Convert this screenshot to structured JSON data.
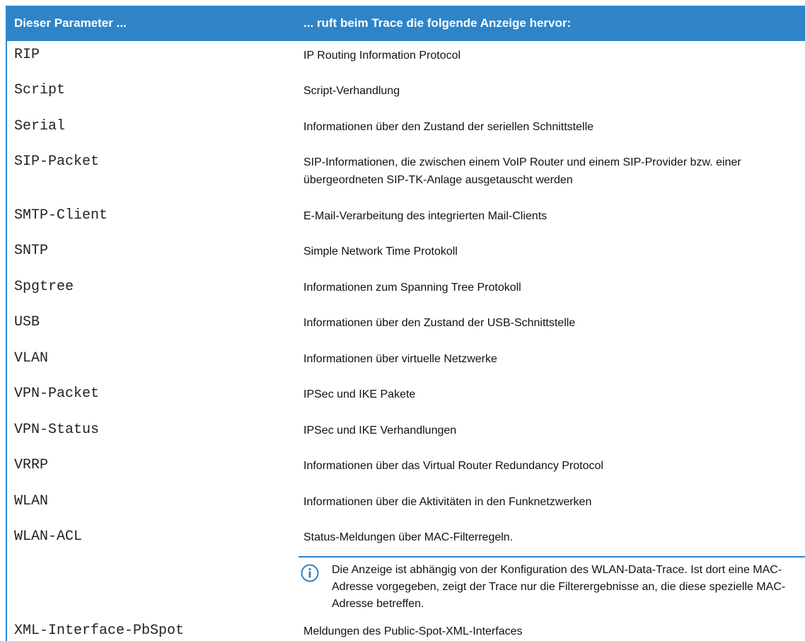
{
  "table": {
    "header": {
      "col1": "Dieser Parameter ...",
      "col2": "... ruft beim Trace die folgende Anzeige hervor:"
    },
    "rows": [
      {
        "param": "RIP",
        "desc": "IP Routing Information Protocol"
      },
      {
        "param": "Script",
        "desc": "Script-Verhandlung"
      },
      {
        "param": "Serial",
        "desc": "Informationen über den Zustand der seriellen Schnittstelle"
      },
      {
        "param": "SIP-Packet",
        "desc": "SIP-Informationen, die zwischen einem VoIP Router und einem SIP-Provider bzw. einer übergeordneten SIP-TK-Anlage ausgetauscht werden"
      },
      {
        "param": "SMTP-Client",
        "desc": "E-Mail-Verarbeitung des integrierten Mail-Clients"
      },
      {
        "param": "SNTP",
        "desc": "Simple Network Time Protokoll"
      },
      {
        "param": "Spgtree",
        "desc": "Informationen zum Spanning Tree Protokoll"
      },
      {
        "param": "USB",
        "desc": "Informationen über den Zustand der USB-Schnittstelle"
      },
      {
        "param": "VLAN",
        "desc": "Informationen über virtuelle Netzwerke"
      },
      {
        "param": "VPN-Packet",
        "desc": "IPSec und IKE Pakete"
      },
      {
        "param": "VPN-Status",
        "desc": "IPSec und IKE Verhandlungen"
      },
      {
        "param": "VRRP",
        "desc": "Informationen über das Virtual Router Redundancy Protocol"
      },
      {
        "param": "WLAN",
        "desc": "Informationen über die Aktivitäten in den Funknetzwerken"
      },
      {
        "param": "WLAN-ACL",
        "desc": "Status-Meldungen über MAC-Filterregeln."
      },
      {
        "param": "XML-Interface-PbSpot",
        "desc": "Meldungen des Public-Spot-XML-Interfaces"
      }
    ],
    "note": {
      "icon": "info-icon",
      "text": "Die Anzeige ist abhängig von der Konfiguration des WLAN-Data-Trace. Ist dort eine MAC-Adresse vorgegeben, zeigt der Trace nur die Filterergebnisse an, die diese spezielle MAC-Adresse betreffen."
    },
    "accent_color": "#2f84c8"
  }
}
